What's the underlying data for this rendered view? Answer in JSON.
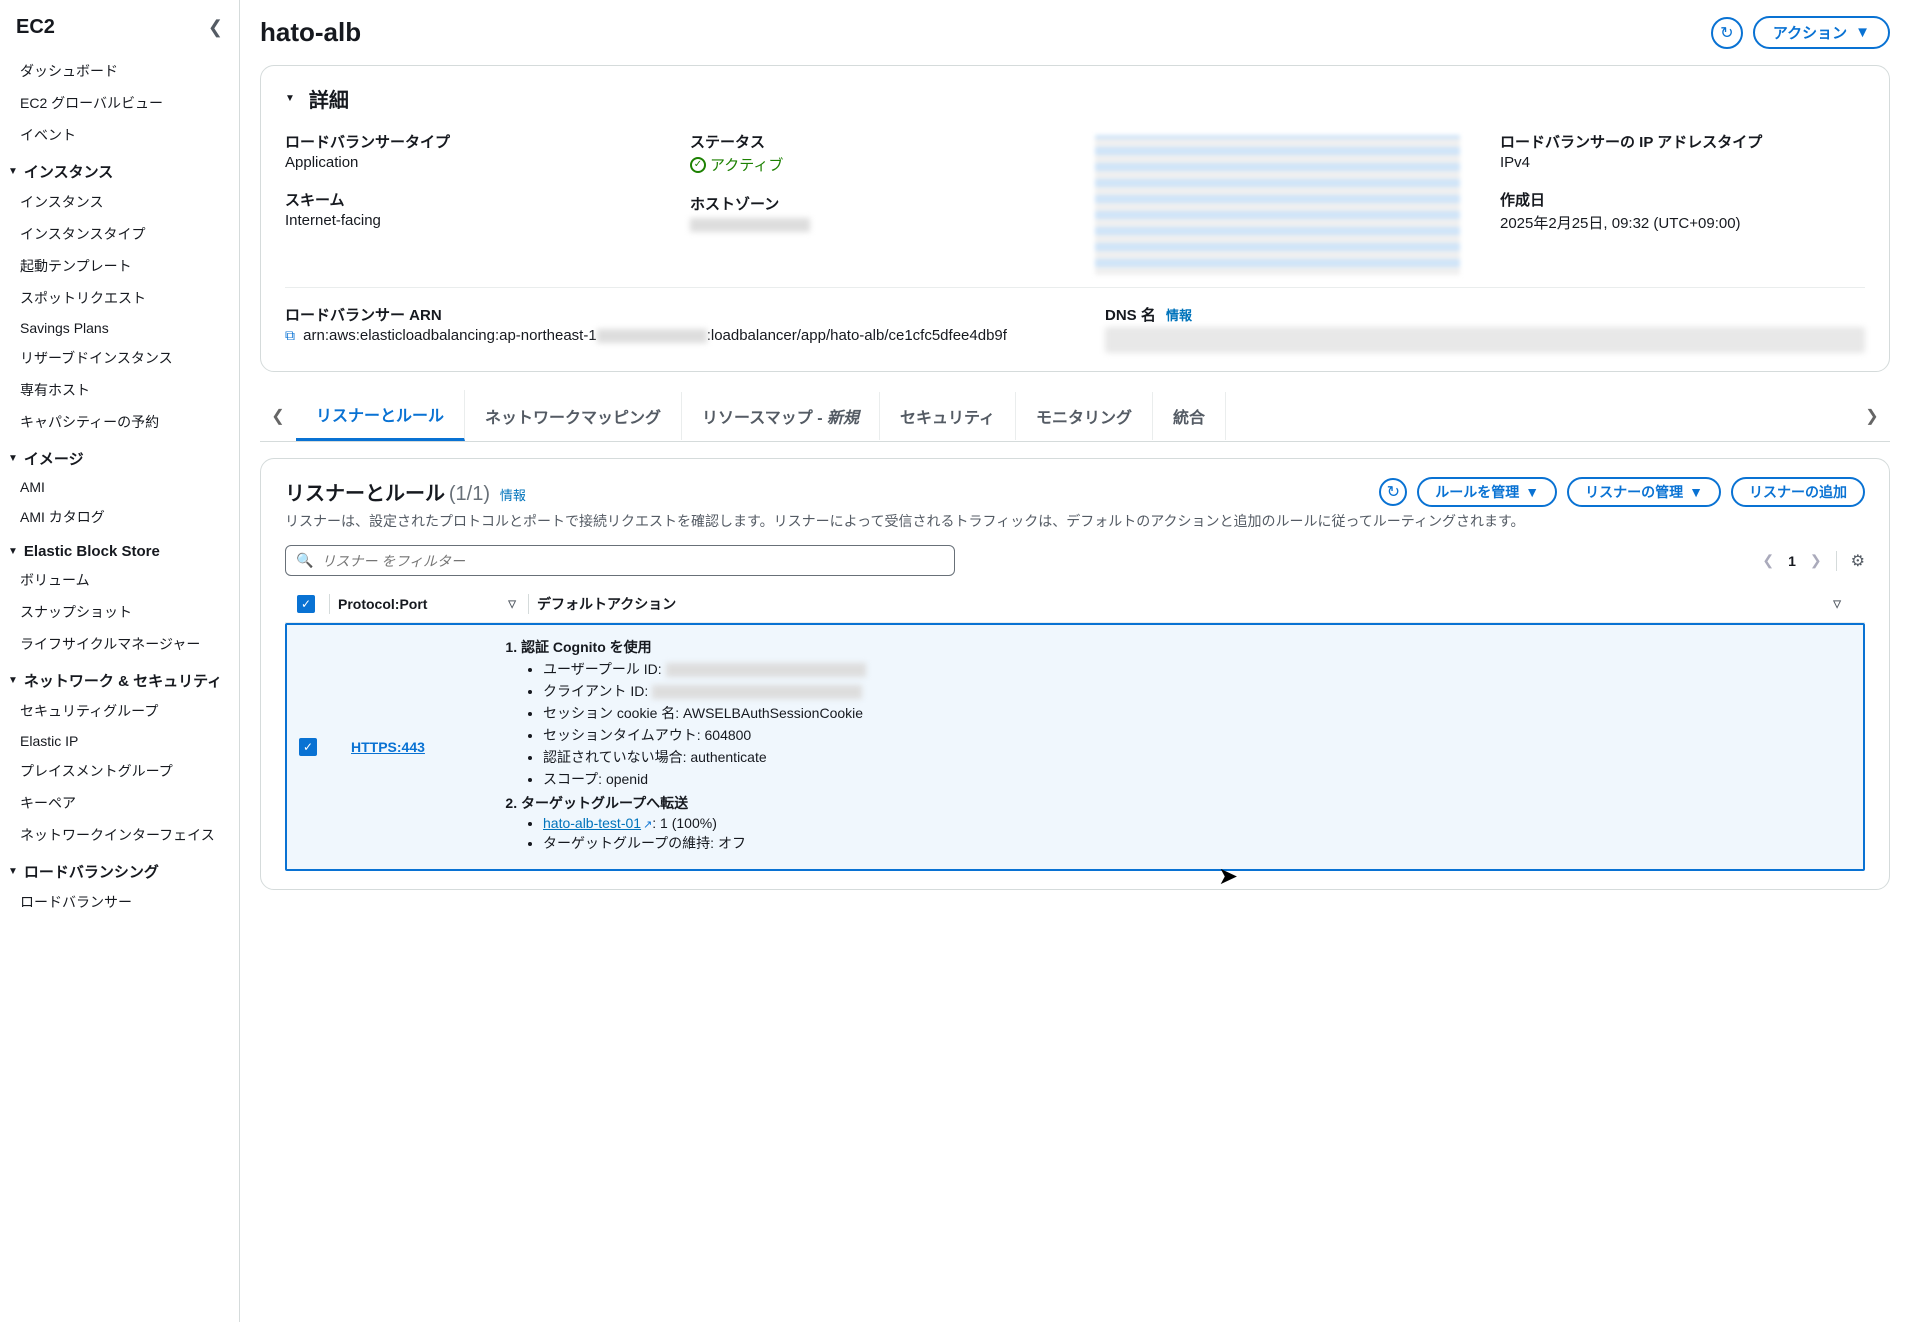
{
  "sidebar": {
    "title": "EC2",
    "items_top": [
      "ダッシュボード",
      "EC2 グローバルビュー",
      "イベント"
    ],
    "sections": [
      {
        "title": "インスタンス",
        "items": [
          "インスタンス",
          "インスタンスタイプ",
          "起動テンプレート",
          "スポットリクエスト",
          "Savings Plans",
          "リザーブドインスタンス",
          "専有ホスト",
          "キャパシティーの予約"
        ]
      },
      {
        "title": "イメージ",
        "items": [
          "AMI",
          "AMI カタログ"
        ]
      },
      {
        "title": "Elastic Block Store",
        "items": [
          "ボリューム",
          "スナップショット",
          "ライフサイクルマネージャー"
        ]
      },
      {
        "title": "ネットワーク & セキュリティ",
        "items": [
          "セキュリティグループ",
          "Elastic IP",
          "プレイスメントグループ",
          "キーペア",
          "ネットワークインターフェイス"
        ]
      },
      {
        "title": "ロードバランシング",
        "items": [
          "ロードバランサー"
        ]
      }
    ]
  },
  "header": {
    "title": "hato-alb",
    "action_label": "アクション"
  },
  "details": {
    "panel_title": "詳細",
    "lb_type_label": "ロードバランサータイプ",
    "lb_type_value": "Application",
    "status_label": "ステータス",
    "status_value": "アクティブ",
    "ip_type_label": "ロードバランサーの IP アドレスタイプ",
    "ip_type_value": "IPv4",
    "scheme_label": "スキーム",
    "scheme_value": "Internet-facing",
    "hostzone_label": "ホストゾーン",
    "created_label": "作成日",
    "created_value": "2025年2月25日, 09:32 (UTC+09:00)",
    "arn_label": "ロードバランサー ARN",
    "arn_value_prefix": "arn:aws:elasticloadbalancing:ap-northeast-1",
    "arn_value_suffix": ":loadbalancer/app/hato-alb/ce1cfc5dfee4db9f",
    "dns_label": "DNS 名",
    "info_text": "情報"
  },
  "tabs": {
    "t0": "リスナーとルール",
    "t1": "ネットワークマッピング",
    "t2": "リソースマップ -",
    "t2_new": " 新規",
    "t3": "セキュリティ",
    "t4": "モニタリング",
    "t5": "統合"
  },
  "listeners": {
    "title": "リスナーとルール",
    "count": "(1/1)",
    "info": "情報",
    "btn_manage_rules": "ルールを管理",
    "btn_manage_listeners": "リスナーの管理",
    "btn_add_listener": "リスナーの追加",
    "desc": "リスナーは、設定されたプロトコルとポートで接続リクエストを確認します。リスナーによって受信されるトラフィックは、デフォルトのアクションと追加のルールに従ってルーティングされます。",
    "filter_placeholder": "リスナー をフィルター",
    "page": "1",
    "col_protocol": "Protocol:Port",
    "col_default_action": "デフォルトアクション",
    "row": {
      "protocol": "HTTPS:443",
      "action1": "認証 Cognito を使用",
      "user_pool_label": "ユーザープール ID:",
      "client_id_label": "クライアント ID:",
      "cookie_label": "セッション cookie 名: ",
      "cookie_value": "AWSELBAuthSessionCookie",
      "timeout_label": "セッションタイムアウト: ",
      "timeout_value": "604800",
      "unauth_label": "認証されていない場合: ",
      "unauth_value": "authenticate",
      "scope_label": "スコープ: ",
      "scope_value": "openid",
      "action2": "ターゲットグループへ転送",
      "tg_name": "hato-alb-test-01",
      "tg_weight": ": 1 (100%)",
      "stickiness_label": "ターゲットグループの維持: ",
      "stickiness_value": "オフ"
    }
  }
}
